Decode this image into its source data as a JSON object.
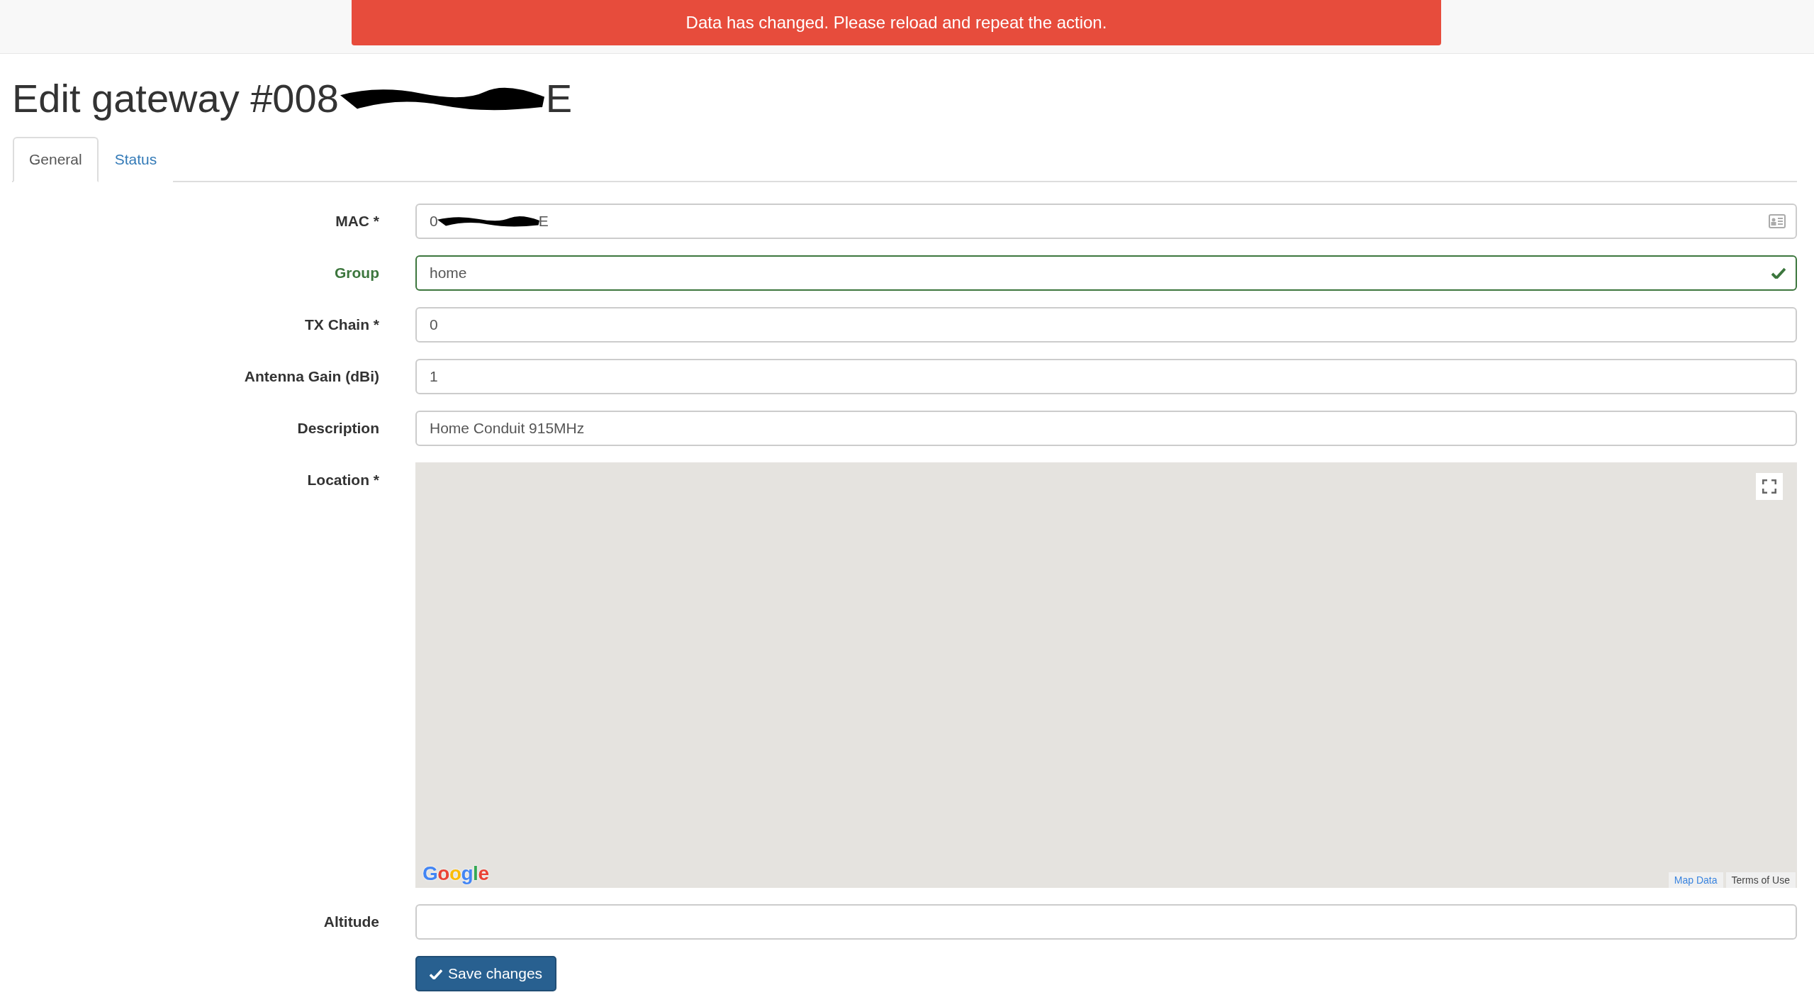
{
  "alert": {
    "text": "Data has changed. Please reload and repeat the action."
  },
  "title": {
    "prefix": "Edit gateway #008",
    "suffix": "E",
    "redacted": true
  },
  "tabs": [
    {
      "label": "General",
      "selected": true
    },
    {
      "label": "Status",
      "selected": false
    }
  ],
  "fields": [
    {
      "kind": "text",
      "label": "MAC *",
      "value_prefix": "0",
      "value_suffix": "E",
      "redacted": true,
      "valid": false,
      "card_icon": true
    },
    {
      "kind": "text",
      "label": "Group",
      "value": "home",
      "valid": true
    },
    {
      "kind": "text",
      "label": "TX Chain *",
      "value": "0",
      "valid": false
    },
    {
      "kind": "text",
      "label": "Antenna Gain (dBi)",
      "value": "1",
      "valid": false
    },
    {
      "kind": "text",
      "label": "Description",
      "value": "Home Conduit 915MHz",
      "valid": false
    },
    {
      "kind": "map",
      "label": "Location *",
      "logo": "Google",
      "links": [
        "Map Data",
        "Terms of Use"
      ]
    },
    {
      "kind": "text",
      "label": "Altitude",
      "valid": false
    }
  ],
  "save_button": {
    "label": "Save changes"
  }
}
